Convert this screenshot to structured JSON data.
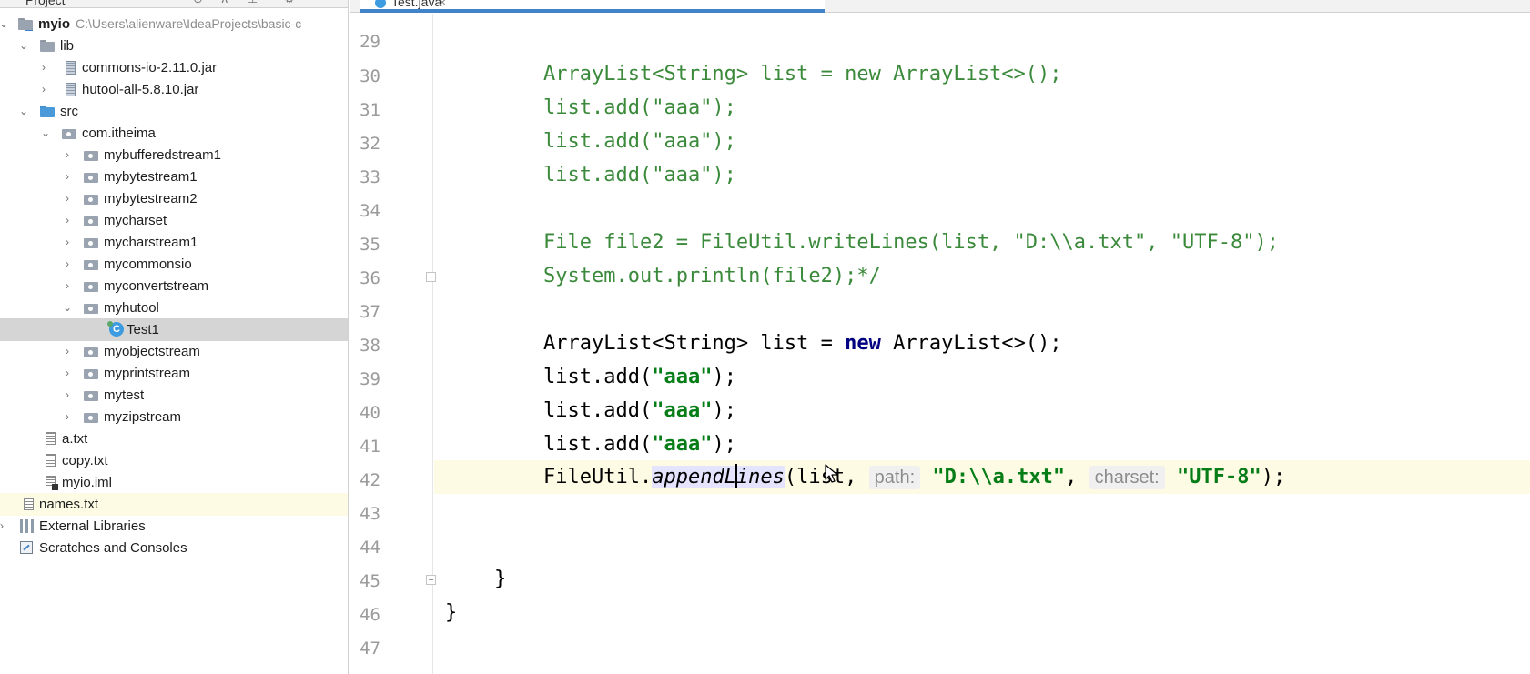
{
  "project_panel": {
    "header": {
      "title": "Project"
    },
    "root": {
      "name": "myio",
      "path": "C:\\Users\\alienware\\IdeaProjects\\basic-c"
    },
    "items": {
      "lib": "lib",
      "commons_io": "commons-io-2.11.0.jar",
      "hutool": "hutool-all-5.8.10.jar",
      "src": "src",
      "com_itheima": "com.itheima",
      "mybufferedstream1": "mybufferedstream1",
      "mybytestream1": "mybytestream1",
      "mybytestream2": "mybytestream2",
      "mycharset": "mycharset",
      "mycharstream1": "mycharstream1",
      "mycommonsio": "mycommonsio",
      "myconvertstream": "myconvertstream",
      "myhutool": "myhutool",
      "test1": "Test1",
      "myobjectstream": "myobjectstream",
      "myprintstream": "myprintstream",
      "mytest": "mytest",
      "myzipstream": "myzipstream",
      "a_txt": "a.txt",
      "copy_txt": "copy.txt",
      "myio_iml": "myio.iml",
      "names_txt": "names.txt",
      "external_libraries": "External Libraries",
      "scratches": "Scratches and Consoles"
    }
  },
  "editor": {
    "tab": {
      "label": "Test.java",
      "close": "×"
    },
    "line_numbers": [
      "29",
      "30",
      "31",
      "32",
      "33",
      "34",
      "35",
      "36",
      "37",
      "38",
      "39",
      "40",
      "41",
      "42",
      "43",
      "44",
      "45",
      "46",
      "47"
    ],
    "code": {
      "l30": "ArrayList<String> list = new ArrayList<>();",
      "l31": "list.add(\"aaa\");",
      "l32": "list.add(\"aaa\");",
      "l33": "list.add(\"aaa\");",
      "l35": "File file2 = FileUtil.writeLines(list, \"D:\\\\a.txt\", \"UTF-8\");",
      "l36": "System.out.println(file2);*/",
      "l38": {
        "a": "ArrayList<String> list = ",
        "kw": "new",
        "b": " ArrayList<>();"
      },
      "add_call": "list.add(",
      "add_arg": "\"aaa\"",
      "add_end": ");",
      "l42": {
        "prefix": "FileUtil.",
        "method_a": "appendL",
        "method_b": "ines",
        "open": "(list, ",
        "hint_path": "path:",
        "arg_path": "\"D:\\\\a.txt\"",
        "sep": ", ",
        "hint_charset": "charset:",
        "arg_charset": "\"UTF-8\"",
        "close": ");"
      },
      "l45": "}",
      "l46": "}"
    }
  },
  "colors": {
    "comment": "#3b8a3b",
    "keyword": "#000080",
    "string": "#067d17",
    "current_line": "#fdfbe3",
    "selection": "#d5d5d5"
  }
}
